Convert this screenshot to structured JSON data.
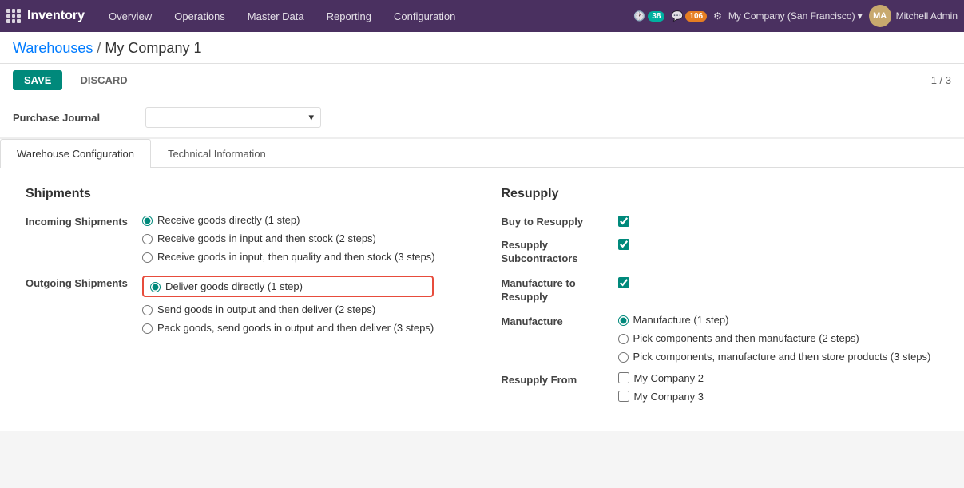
{
  "app": {
    "logo_label": "Inventory",
    "nav_items": [
      "Overview",
      "Operations",
      "Master Data",
      "Reporting",
      "Configuration"
    ],
    "badge_clock": "38",
    "badge_chat": "106",
    "company": "My Company (San Francisco)",
    "user": "Mitchell Admin"
  },
  "breadcrumb": {
    "parent": "Warehouses",
    "current": "My Company 1"
  },
  "actions": {
    "save": "SAVE",
    "discard": "DISCARD",
    "pagination": "1 / 3"
  },
  "purchase_journal": {
    "label": "Purchase Journal",
    "value": ""
  },
  "tabs": [
    {
      "id": "warehouse-config",
      "label": "Warehouse Configuration",
      "active": true
    },
    {
      "id": "technical-info",
      "label": "Technical Information",
      "active": false
    }
  ],
  "shipments": {
    "section_title": "Shipments",
    "incoming": {
      "label": "Incoming Shipments",
      "options": [
        {
          "id": "inc1",
          "label": "Receive goods directly (1 step)",
          "selected": true
        },
        {
          "id": "inc2",
          "label": "Receive goods in input and then stock (2 steps)",
          "selected": false
        },
        {
          "id": "inc3",
          "label": "Receive goods in input, then quality and then stock (3 steps)",
          "selected": false
        }
      ]
    },
    "outgoing": {
      "label": "Outgoing Shipments",
      "options": [
        {
          "id": "out1",
          "label": "Deliver goods directly (1 step)",
          "selected": true,
          "highlighted": true
        },
        {
          "id": "out2",
          "label": "Send goods in output and then deliver (2 steps)",
          "selected": false
        },
        {
          "id": "out3",
          "label": "Pack goods, send goods in output and then deliver (3 steps)",
          "selected": false
        }
      ]
    }
  },
  "resupply": {
    "section_title": "Resupply",
    "checkboxes": [
      {
        "id": "buy",
        "label": "Buy to Resupply",
        "checked": true
      },
      {
        "id": "subcontractors",
        "label": "Resupply Subcontractors",
        "checked": true
      },
      {
        "id": "manufacture_resupply",
        "label": "Manufacture to Resupply",
        "checked": true
      }
    ],
    "manufacture": {
      "label": "Manufacture",
      "options": [
        {
          "id": "mfg1",
          "label": "Manufacture (1 step)",
          "selected": true
        },
        {
          "id": "mfg2",
          "label": "Pick components and then manufacture (2 steps)",
          "selected": false
        },
        {
          "id": "mfg3",
          "label": "Pick components, manufacture and then store products (3 steps)",
          "selected": false
        }
      ]
    },
    "resupply_from": {
      "label": "Resupply From",
      "companies": [
        {
          "id": "comp2",
          "label": "My Company 2",
          "checked": false
        },
        {
          "id": "comp3",
          "label": "My Company 3",
          "checked": false
        }
      ]
    }
  }
}
